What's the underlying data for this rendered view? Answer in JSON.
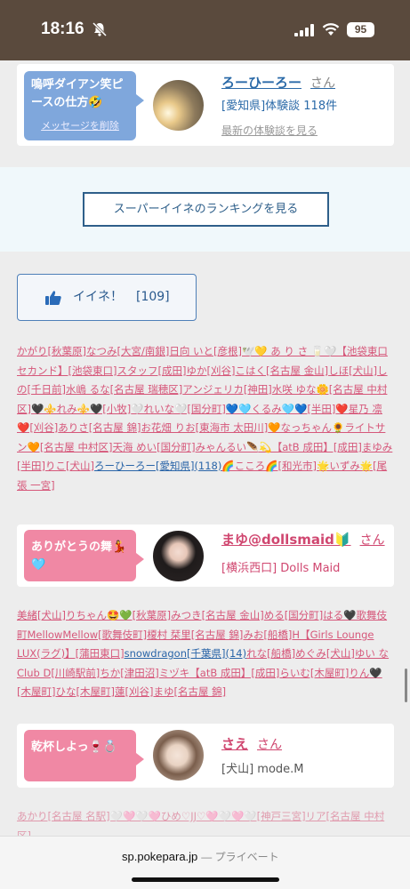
{
  "status": {
    "time": "18:16",
    "battery": "95"
  },
  "cards": {
    "card1": {
      "bubble": "嗚呼ダイアン笑ピースの仕方🤣",
      "delete": "メッセージを削除",
      "name": "ろーひーろー",
      "suffix": "さん",
      "area_count": "[愛知県]体験談 118件",
      "latest_link": "最新の体験談を見る"
    },
    "card2": {
      "bubble": "ありがとうの舞💃🩵",
      "name": "まゆ@dollsmaid🔰",
      "suffix": "さん",
      "shop": "[横浜西口] Dolls Maid"
    },
    "card3": {
      "bubble": "乾杯しよっ🍷💍",
      "name": "さえ",
      "suffix": "さん",
      "shop": "[犬山] mode.M"
    }
  },
  "ranking_button": "スーパーイイネのランキングを見る",
  "like": {
    "label": "イイネ！",
    "count": "[109]"
  },
  "list1": [
    "かがり[秋葉原]",
    "なつみ[大宮/南銀]",
    "日向 いと[彦根]",
    "🕊️💛 あ り さ 🥛🤍【池袋東口 セカンド】[池袋東口]",
    "スタッフ[成田]",
    "ゆか[刈谷]",
    "こはく[名古屋 金山]",
    "しほ[犬山]",
    "しの[千日前]",
    "水嶋 るな[名古屋 瑞穂区]",
    "アンジェリカ[神田]",
    "水咲 ゆな🌼[名古屋 中村区]",
    "🖤⚜️れみ⚜️🖤[小牧]",
    "🤍れいな🤍[国分町]",
    "💙🩵くるみ🩵💙[半田]",
    "❤️星乃 凛❤️[刈谷]",
    "ありさ[名古屋 錦]",
    "お花畑 りお[東海市 太田川]",
    "🧡なっちゃん🌻ライトサン🧡[名古屋 中村区]",
    "天海 めい[国分町]",
    "みゃんるい🪶💫【atB 成田】[成田]",
    "まゆみ[半田]",
    "りこ[犬山]"
  ],
  "list1_blue": "ろーひーろー[愛知県](118)",
  "list1_tail": [
    "🌈こころ🌈[和光市]",
    "🌟いずみ🌟[尾張 一宮]"
  ],
  "list2": [
    "美緒[犬山]",
    "りちゃん🤩💚[秋葉原]",
    "みつき[名古屋 金山]",
    "める[国分町]",
    "はる🖤歌舞伎町MellowMellow[歌舞伎町]",
    "榎村 栞里[名古屋 錦]",
    "みお[船橋]",
    "H【Girls Lounge LUX(ラグ)】[蒲田東口]"
  ],
  "list2_blue": "snowdragon[千葉県](14)",
  "list2_tail": [
    "れな[船橋]",
    "めぐみ[犬山]",
    "ゆい な Club D[川崎駅前]",
    "ちか[津田沼]",
    "ミヅキ【atB 成田】[成田]",
    "らいむ[木屋町]",
    "りん🖤[木屋町]",
    "ひな[木屋町]",
    "蓮[刈谷]",
    "まゆ[名古屋 錦]"
  ],
  "list3_partial": "あかり[名古屋 名駅]🤍🩷🤍🩷ひめ♡JJ♡🩷🤍🩷🤍[神戸三宮]リア[名古屋 中村区]",
  "browser": {
    "domain": "sp.pokepara.jp",
    "private": "— プライベート"
  }
}
